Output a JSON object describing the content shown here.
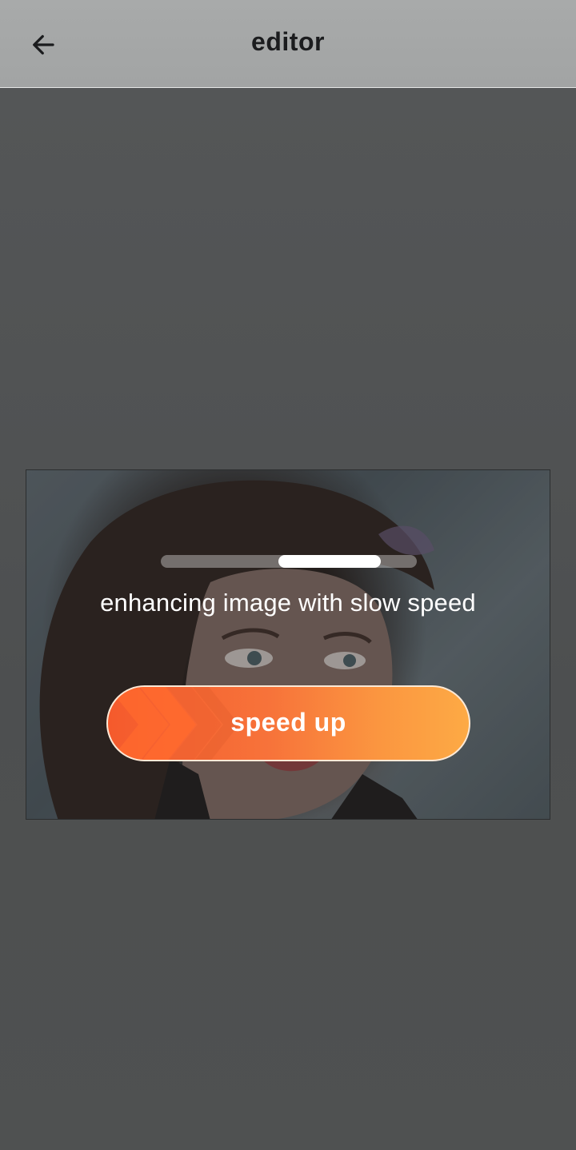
{
  "appbar": {
    "title": "editor",
    "back_icon": "arrow-left-icon"
  },
  "editor": {
    "image_description_icon": "photo",
    "progress": {
      "fraction": 0.4,
      "mode": "indeterminate"
    },
    "status_text": "enhancing image with slow speed",
    "speed_up_label": "speed up",
    "button_icon": "chevron-right-icon"
  },
  "colors": {
    "appbar_bg": "#a5a7a7",
    "title_text": "#1b1c1e",
    "button_gradient_start": "#f55a2c",
    "button_gradient_end": "#fdaa45",
    "button_border": "#fde9d6",
    "overlay_text": "#ffffff"
  }
}
